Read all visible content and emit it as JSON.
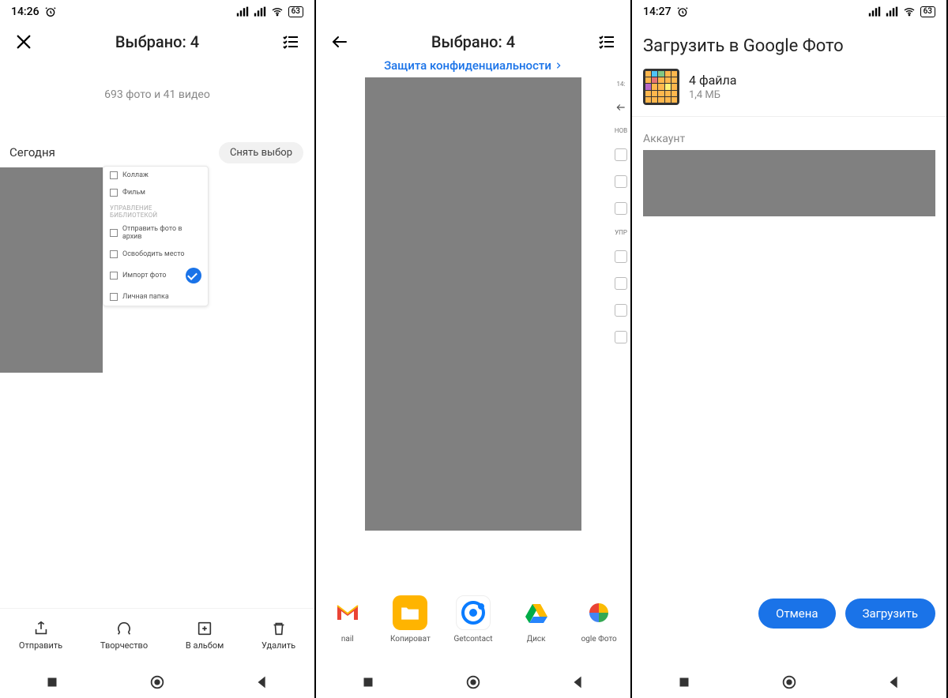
{
  "status": {
    "time1": "14:26",
    "time2": "14:27",
    "battery": "63"
  },
  "screen1": {
    "title": "Выбрано: 4",
    "subtitle": "693 фото и 41 видео",
    "today": "Сегодня",
    "deselect": "Снять выбор",
    "menu": {
      "collage": "Коллаж",
      "movie": "Фильм",
      "section": "Управление библиотекой",
      "archive": "Отправить фото в архив",
      "freeup": "Освободить место",
      "import": "Импорт фото",
      "locked": "Личная папка"
    },
    "actions": {
      "send": "Отправить",
      "create": "Творчество",
      "album": "В альбом",
      "delete": "Удалить"
    }
  },
  "screen2": {
    "title": "Выбрано: 4",
    "privacy": "Защита конфиденциальности",
    "sidebar": {
      "new": "НОВ",
      "manage": "УПР"
    },
    "share": {
      "gmail": "nail",
      "copy": "Копироват",
      "getcontact": "Getcontact",
      "drive": "Диск",
      "photos": "ogle Фото"
    }
  },
  "screen3": {
    "title": "Загрузить в Google Фото",
    "files": "4 файла",
    "size": "1,4 МБ",
    "account": "Аккаунт",
    "cancel": "Отмена",
    "upload": "Загрузить"
  }
}
